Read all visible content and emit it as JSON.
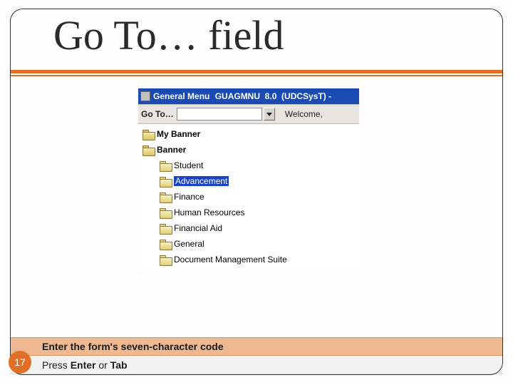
{
  "title": "Go To… field",
  "app": {
    "window_title_prefix": "General Menu ",
    "window_title_suffix": "GUAGMNU  8.0  (UDCSysT) -",
    "goto_label": "Go To…",
    "welcome": "Welcome,"
  },
  "tree": {
    "top": [
      {
        "label": "My Banner"
      },
      {
        "label": "Banner"
      }
    ],
    "sub": [
      {
        "label": "Student"
      },
      {
        "label": "Advancement",
        "selected": true
      },
      {
        "label": "Finance"
      },
      {
        "label": "Human Resources"
      },
      {
        "label": "Financial Aid"
      },
      {
        "label": "General"
      },
      {
        "label": "Document Management Suite"
      }
    ]
  },
  "footer": {
    "line1": "Enter the form's seven-character code",
    "line2_prefix": "Press ",
    "line2_b1": "Enter",
    "line2_mid": " or ",
    "line2_b2": "Tab"
  },
  "slide_number": "17"
}
